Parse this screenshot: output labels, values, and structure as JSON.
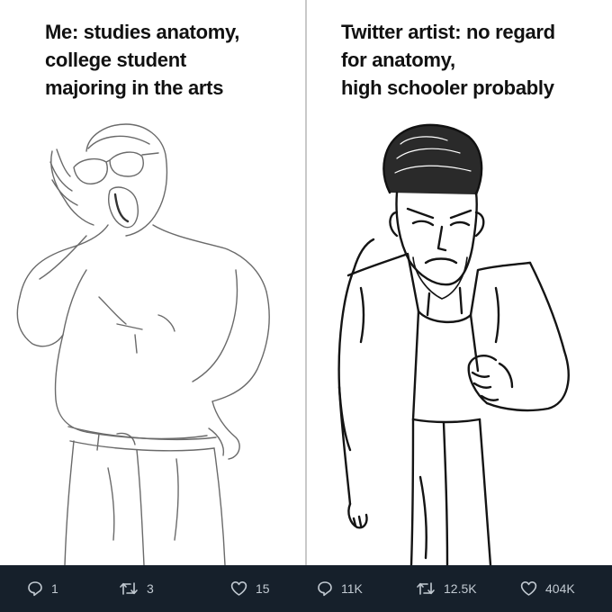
{
  "panels": [
    {
      "caption": [
        "Me: studies anatomy,",
        "college student",
        "majoring in the arts"
      ],
      "stats": {
        "replies": "1",
        "retweets": "3",
        "likes": "15"
      }
    },
    {
      "caption": [
        "Twitter artist: no regard",
        "for anatomy,",
        "high schooler probably"
      ],
      "stats": {
        "replies": "11K",
        "retweets": "12.5K",
        "likes": "404K"
      }
    }
  ],
  "icons": {
    "reply": "reply-icon",
    "retweet": "retweet-icon",
    "like": "heart-icon"
  },
  "colors": {
    "stat_bar": "#16202b",
    "stat_text": "#c2cad2"
  }
}
